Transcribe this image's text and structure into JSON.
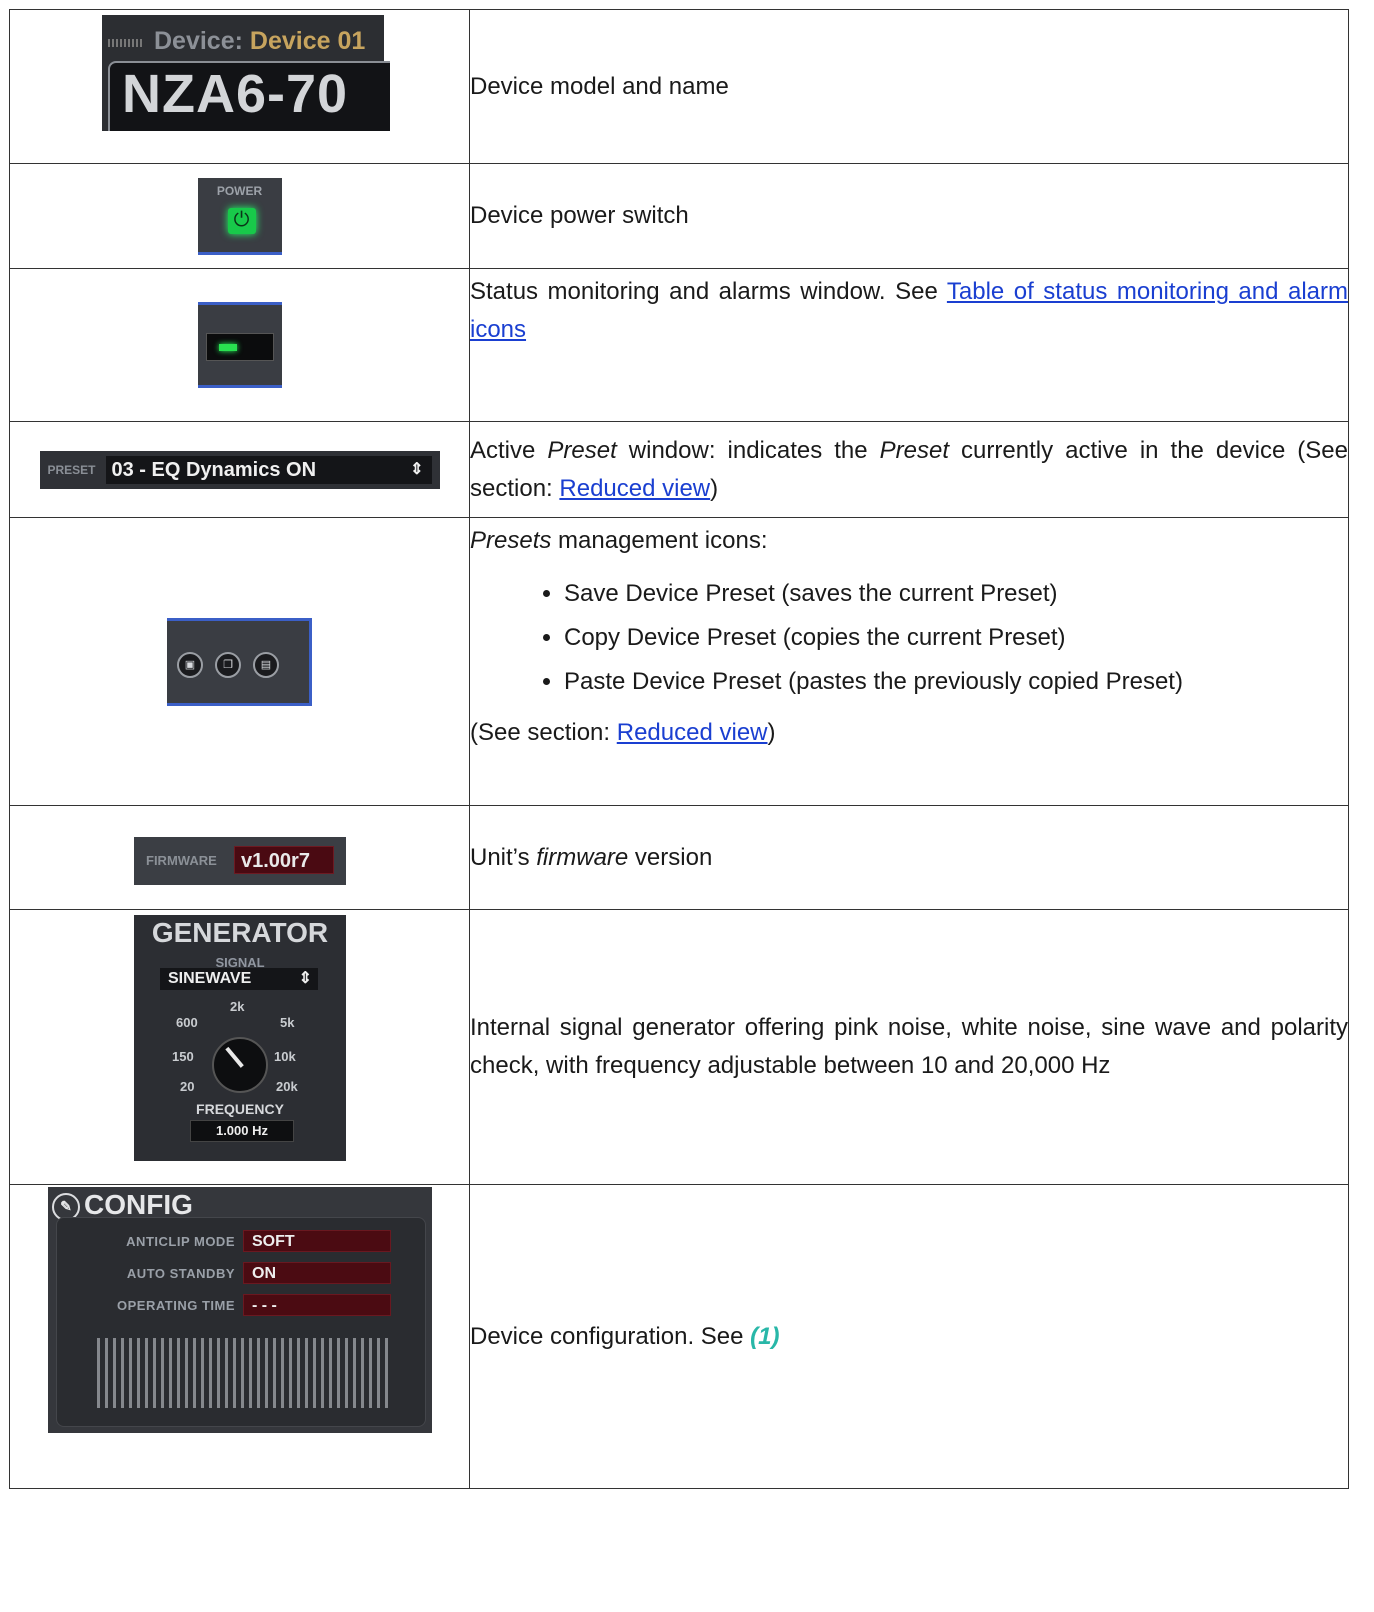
{
  "rows": [
    {
      "name": "device-model-name",
      "image": {
        "device_label": "Device:",
        "device_name": "Device 01",
        "model": "NZA6-70"
      },
      "text": "Device model and name"
    },
    {
      "name": "power-switch",
      "image": {
        "label": "POWER",
        "icon": "power-icon",
        "state_color": "#18c94a"
      },
      "text": "Device power switch"
    },
    {
      "name": "status-window",
      "image": {
        "led_color": "#29e050"
      },
      "text_before": "Status monitoring and alarms window. See ",
      "link": "Table of status monitoring and alarm icons"
    },
    {
      "name": "active-preset",
      "image": {
        "label": "PRESET",
        "value": "03 - EQ Dynamics ON",
        "arrow": "⇕"
      },
      "t1": "Active ",
      "t1_em": "Preset",
      "t2": " window: indicates the ",
      "t2_em": "Preset",
      "t3": " currently active in the device (See section: ",
      "link": "Reduced view",
      "t4": ")"
    },
    {
      "name": "preset-management",
      "image": {
        "icons": [
          "save-icon",
          "copy-icon",
          "paste-icon"
        ]
      },
      "intro_em": "Presets",
      "intro": " management icons:",
      "bullets": [
        "Save Device Preset (saves the current Preset)",
        "Copy Device Preset (copies the current Preset)",
        "Paste Device Preset (pastes the previously copied Preset)"
      ],
      "see": "(See section: ",
      "link": "Reduced view",
      "see_end": ")"
    },
    {
      "name": "firmware",
      "image": {
        "label": "FIRMWARE",
        "value": "v1.00r7"
      },
      "t1": "Unit’s ",
      "t1_em": "firmware",
      "t2": " version"
    },
    {
      "name": "generator",
      "image": {
        "title": "GENERATOR",
        "signal_label": "SIGNAL",
        "signal": "SINEWAVE",
        "arrow": "⇕",
        "ticks": [
          "2k",
          "600",
          "5k",
          "150",
          "10k",
          "20",
          "20k"
        ],
        "freq_label": "FREQUENCY",
        "freq_value": "1.000 Hz"
      },
      "text": "Internal signal generator offering pink noise, white noise, sine wave and polarity check, with frequency adjustable between 10 and 20,000 Hz"
    },
    {
      "name": "config",
      "image": {
        "title": "CONFIG",
        "rows": [
          {
            "label": "ANTICLIP MODE",
            "value": "SOFT"
          },
          {
            "label": "AUTO STANDBY",
            "value": "ON"
          },
          {
            "label": "OPERATING TIME",
            "value": "- - -"
          }
        ]
      },
      "text": "Device configuration. See ",
      "ref": "(1)",
      "ref_color": "#28b7a8"
    }
  ]
}
